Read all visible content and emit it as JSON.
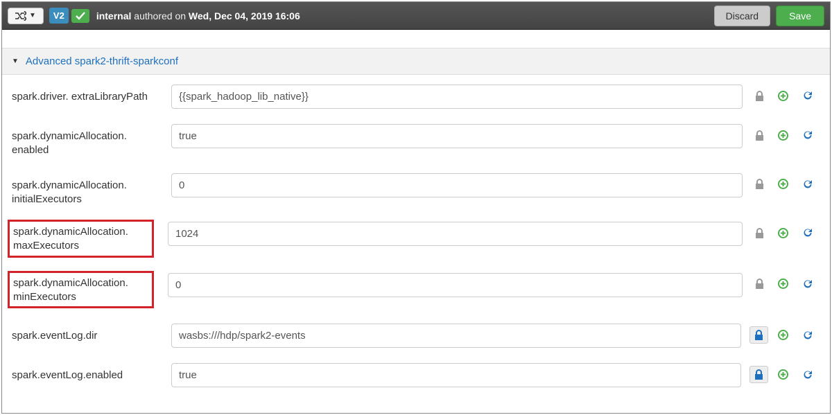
{
  "topbar": {
    "version": "V2",
    "user": "internal",
    "verb": "authored on",
    "date": "Wed, Dec 04, 2019 16:06",
    "discard": "Discard",
    "save": "Save"
  },
  "section": {
    "title": "Advanced spark2-thrift-sparkconf"
  },
  "properties": [
    {
      "label": "spark.driver. extraLibraryPath",
      "value": "{{spark_hadoop_lib_native}}",
      "lock_active": false,
      "highlighted": false
    },
    {
      "label": "spark.dynamicAllocation. enabled",
      "value": "true",
      "lock_active": false,
      "highlighted": false
    },
    {
      "label": "spark.dynamicAllocation. initialExecutors",
      "value": "0",
      "lock_active": false,
      "highlighted": false
    },
    {
      "label": "spark.dynamicAllocation. maxExecutors",
      "value": "1024",
      "lock_active": false,
      "highlighted": true
    },
    {
      "label": "spark.dynamicAllocation. minExecutors",
      "value": "0",
      "lock_active": false,
      "highlighted": true
    },
    {
      "label": "spark.eventLog.dir",
      "value": "wasbs:///hdp/spark2-events",
      "lock_active": true,
      "highlighted": false
    },
    {
      "label": "spark.eventLog.enabled",
      "value": "true",
      "lock_active": true,
      "highlighted": false
    }
  ]
}
